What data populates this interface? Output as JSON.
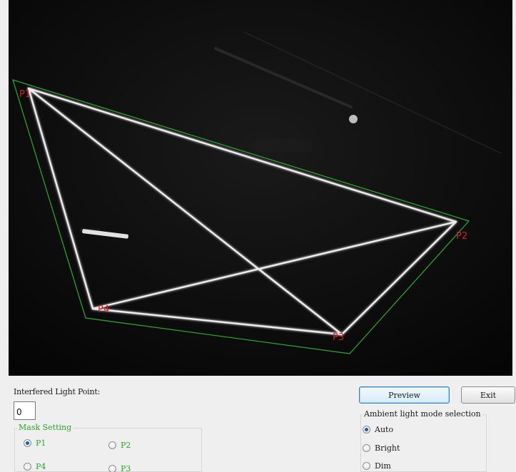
{
  "camera": {
    "point_labels": {
      "p1": "P1",
      "p2": "P2",
      "p3": "P3",
      "p4": "P4"
    },
    "colors": {
      "background": "#0b0b0b",
      "laser_lines": "#ececec",
      "mask_outline": "#2ea02e",
      "point_label": "#d0202a"
    }
  },
  "interfered_light": {
    "label": "Interfered Light Point:",
    "value": "0"
  },
  "mask_setting": {
    "title": "Mask Setting",
    "options": [
      {
        "label": "P1",
        "checked": true
      },
      {
        "label": "P2",
        "checked": false
      },
      {
        "label": "P4",
        "checked": false
      },
      {
        "label": "P3",
        "checked": false
      }
    ]
  },
  "buttons": {
    "preview": "Preview",
    "exit": "Exit"
  },
  "ambient": {
    "title": "Ambient light mode selection",
    "options": [
      {
        "label": "Auto",
        "checked": true
      },
      {
        "label": "Bright",
        "checked": false
      },
      {
        "label": "Dim",
        "checked": false
      }
    ]
  }
}
